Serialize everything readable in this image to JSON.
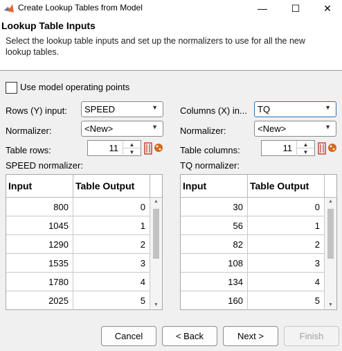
{
  "window": {
    "title": "Create Lookup Tables from Model",
    "controls": {
      "minimize": "—",
      "maximize": "☐",
      "close": "✕"
    }
  },
  "header": {
    "title": "Lookup Table Inputs",
    "description": "Select the lookup table inputs and set up the normalizers to use for all the new lookup tables."
  },
  "options": {
    "use_operating_points_label": "Use model operating points",
    "use_operating_points_checked": false
  },
  "rows": {
    "input_label": "Rows (Y) input:",
    "input_value": "SPEED",
    "normalizer_label": "Normalizer:",
    "normalizer_value": "<New>",
    "count_label": "Table rows:",
    "count_value": "11",
    "table_label": "SPEED normalizer:",
    "table": {
      "columns": [
        "Input",
        "Table Output"
      ],
      "rows": [
        [
          "800",
          "0"
        ],
        [
          "1045",
          "1"
        ],
        [
          "1290",
          "2"
        ],
        [
          "1535",
          "3"
        ],
        [
          "1780",
          "4"
        ],
        [
          "2025",
          "5"
        ]
      ]
    }
  },
  "columns": {
    "input_label": "Columns (X) in...",
    "input_value": "TQ",
    "normalizer_label": "Normalizer:",
    "normalizer_value": "<New>",
    "count_label": "Table columns:",
    "count_value": "11",
    "table_label": "TQ normalizer:",
    "table": {
      "columns": [
        "Input",
        "Table Output"
      ],
      "rows": [
        [
          "30",
          "0"
        ],
        [
          "56",
          "1"
        ],
        [
          "82",
          "2"
        ],
        [
          "108",
          "3"
        ],
        [
          "134",
          "4"
        ],
        [
          "160",
          "5"
        ]
      ]
    }
  },
  "buttons": {
    "cancel": "Cancel",
    "back": "< Back",
    "next": "Next >",
    "finish": "Finish"
  },
  "colors": {
    "accent": "#2b6fb6",
    "delete_red": "#c0392b",
    "cookie_orange": "#d2691e"
  },
  "icons": {
    "app": "matlab-logo-icon",
    "delete": "delete-icon",
    "fill": "fill-icon"
  }
}
